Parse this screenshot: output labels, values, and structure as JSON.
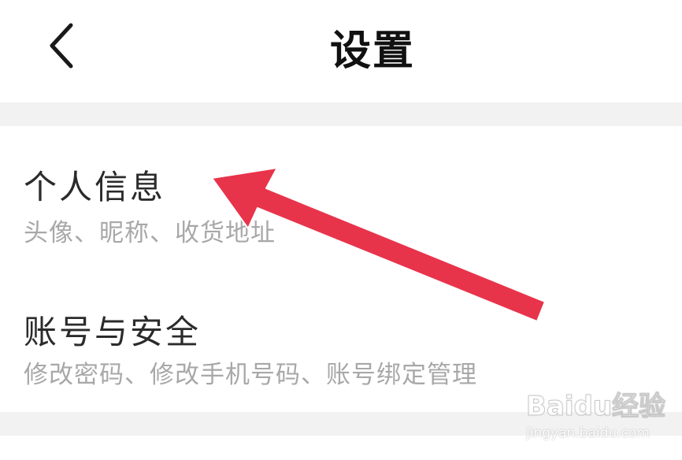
{
  "header": {
    "title": "设置",
    "back_icon": "chevron-left-icon"
  },
  "settings": [
    {
      "title": "个人信息",
      "subtitle": "头像、昵称、收货地址"
    },
    {
      "title": "账号与安全",
      "subtitle": "修改密码、修改手机号码、账号绑定管理"
    }
  ],
  "annotation": {
    "arrow_color": "#e8344b",
    "icon": "red-arrow-annotation"
  },
  "watermark": {
    "brand": "Baidu经验",
    "url": "jingyan.baidu.com"
  },
  "colors": {
    "background": "#ffffff",
    "separator": "#f2f2f2",
    "title_text": "#2b2b2b",
    "subtitle_text": "#a8a8a8"
  }
}
